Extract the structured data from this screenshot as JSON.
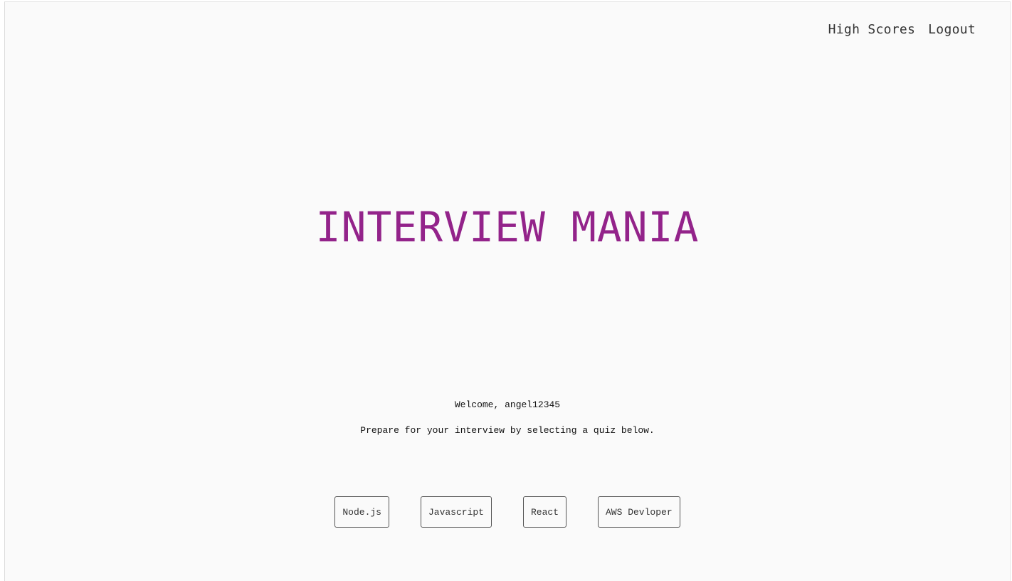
{
  "nav": {
    "high_scores": "High Scores",
    "logout": "Logout"
  },
  "title": "INTERVIEW MANIA",
  "welcome": "Welcome, angel12345",
  "prompt": "Prepare for your interview by selecting a quiz below.",
  "quizzes": [
    {
      "label": "Node.js"
    },
    {
      "label": "Javascript"
    },
    {
      "label": "React"
    },
    {
      "label": "AWS Devloper"
    }
  ],
  "colors": {
    "title": "#93238a",
    "background": "#fafafa",
    "text": "#111111"
  }
}
